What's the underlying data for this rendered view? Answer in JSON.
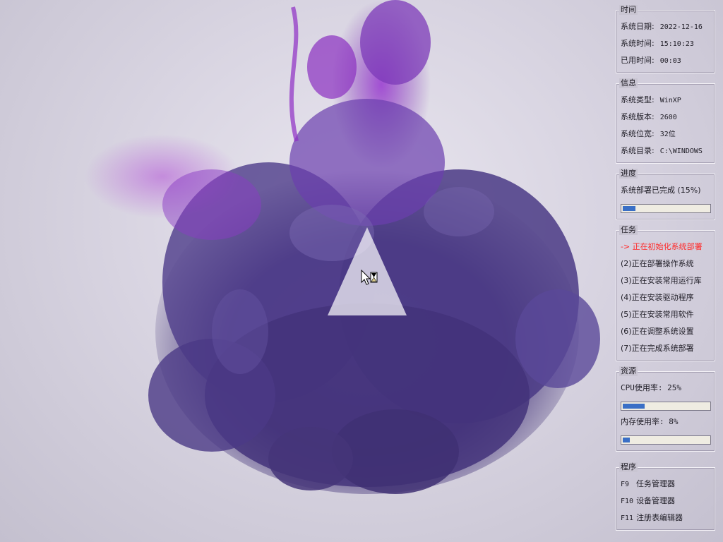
{
  "panels": {
    "time": {
      "title": "时间",
      "rows": [
        {
          "label": "系统日期:",
          "value": "2022-12-16"
        },
        {
          "label": "系统时间:",
          "value": "15:10:23"
        },
        {
          "label": "已用时间:",
          "value": "00:03"
        }
      ]
    },
    "info": {
      "title": "信息",
      "rows": [
        {
          "label": "系统类型:",
          "value": "WinXP"
        },
        {
          "label": "系统版本:",
          "value": "2600"
        },
        {
          "label": "系统位宽:",
          "value": "32位"
        },
        {
          "label": "系统目录:",
          "value": "C:\\WINDOWS"
        }
      ]
    },
    "progress": {
      "title": "进度",
      "status": "系统部署已完成 (15%)",
      "percent": 15
    },
    "tasks": {
      "title": "任务",
      "items": [
        "-> 正在初始化系统部署",
        "(2)正在部署操作系统",
        "(3)正在安装常用运行库",
        "(4)正在安装驱动程序",
        "(5)正在安装常用软件",
        "(6)正在调整系统设置",
        "(7)正在完成系统部署"
      ],
      "active_color": "#ff2a2a"
    },
    "resources": {
      "title": "资源",
      "cpu_label": "CPU使用率:  25%",
      "cpu_percent": 25,
      "mem_label": "内存使用率: 8%",
      "mem_percent": 8
    },
    "programs": {
      "title": "程序",
      "items": [
        {
          "key": "F9",
          "name": "任务管理器"
        },
        {
          "key": "F10",
          "name": "设备管理器"
        },
        {
          "key": "F11",
          "name": "注册表编辑器"
        }
      ]
    }
  },
  "colors": {
    "accent": "#3a6fc6",
    "bar_track": "#efece2",
    "smoke_dark": "#4a3a8a",
    "smoke_bright": "#8e3fc8"
  },
  "icons": {
    "logo": "triangle-logo-icon",
    "cursor": "busy-cursor-icon"
  }
}
